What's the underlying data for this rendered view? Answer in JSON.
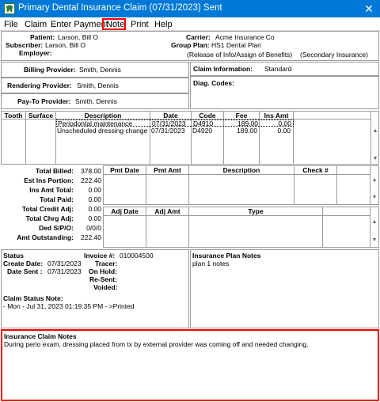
{
  "window": {
    "title": "Primary Dental Insurance Claim (07/31/2023) Sent",
    "close": "✕",
    "icon": "tooth-icon"
  },
  "menu": [
    "File",
    "Claim",
    "Enter Payment",
    "Note",
    "Print",
    "Help"
  ],
  "header": {
    "patient_label": "Patient:",
    "patient": "Larson, Bill O",
    "subscriber_label": "Subscriber:",
    "subscriber": "Larson, Bill O",
    "employer_label": "Employer:",
    "carrier_label": "Carrier:",
    "carrier": "Acme Insurance Co",
    "group_plan_label": "Group Plan:",
    "group_plan": "HS1 Dental Plan",
    "release_info": "(Release of Info/Assign of Benefits)",
    "secondary_insurance": "(Secondary Insurance)"
  },
  "providers": {
    "billing_label": "Billing Provider:",
    "billing": "Smith, Dennis",
    "rendering_label": "Rendering Provider:",
    "rendering": "Smith, Dennis",
    "paytoprov_label": "Pay-To Provider:",
    "paytoprov": "Smith, Dennis"
  },
  "claim_info": {
    "label": "Claim Information:",
    "value": "Standard",
    "diag_label": "Diag. Codes:"
  },
  "procedures": {
    "columns": [
      "Tooth",
      "Surface",
      "Description",
      "Date",
      "Code",
      "Fee",
      "Ins Amt"
    ],
    "rows": [
      {
        "tooth": "",
        "surface": "",
        "description": "Periodontal maintenance",
        "date": "07/31/2023",
        "code": "D4910",
        "fee": "189.00",
        "ins_amt": "0.00"
      },
      {
        "tooth": "",
        "surface": "",
        "description": "Unscheduled dressing change",
        "date": "07/31/2023",
        "code": "D4920",
        "fee": "189.00",
        "ins_amt": "0.00"
      }
    ]
  },
  "totals": [
    {
      "label": "Total Billed:",
      "value": "378.00"
    },
    {
      "label": "Est Ins Portion:",
      "value": "222.40"
    },
    {
      "label": "Ins Amt Total:",
      "value": "0.00"
    },
    {
      "label": "Total Paid:",
      "value": "0.00"
    },
    {
      "label": "Total Credit Adj:",
      "value": "0.00"
    },
    {
      "label": "Total Chrg Adj:",
      "value": "0.00"
    },
    {
      "label": "Ded S/P/O:",
      "value": "0/0/0"
    },
    {
      "label": "Amt Outstanding:",
      "value": "222.40"
    }
  ],
  "payments": {
    "columns": [
      "Pmt Date",
      "Pmt Amt",
      "Description",
      "Check #"
    ]
  },
  "adjustments": {
    "columns": [
      "Adj Date",
      "Adj Amt",
      "Type"
    ]
  },
  "status": {
    "title": "Status",
    "invoice_label": "Invoice #:",
    "invoice": "010004500",
    "create_date_label": "Create Date:",
    "create_date": "07/31/2023",
    "tracer_label": "Tracer:",
    "date_sent_label": "Date Sent :",
    "date_sent": "07/31/2023",
    "on_hold_label": "On Hold:",
    "resent_label": "Re-Sent:",
    "voided_label": "Voided:",
    "claim_status_note_label": "Claim Status Note:",
    "claim_status_note": "- Mon - Jul 31, 2023 01:19:35 PM - >Printed"
  },
  "plan_notes": {
    "title": "Insurance Plan Notes",
    "text": "plan 1 notes"
  },
  "claim_notes": {
    "title": "Insurance Claim Notes",
    "text": "During perio exam, dressing placed from tx by external provider was coming off and needed changing."
  },
  "colors": {
    "titlebar": "#0078d7",
    "highlight": "#ff0000",
    "border": "#9a9a9a"
  }
}
